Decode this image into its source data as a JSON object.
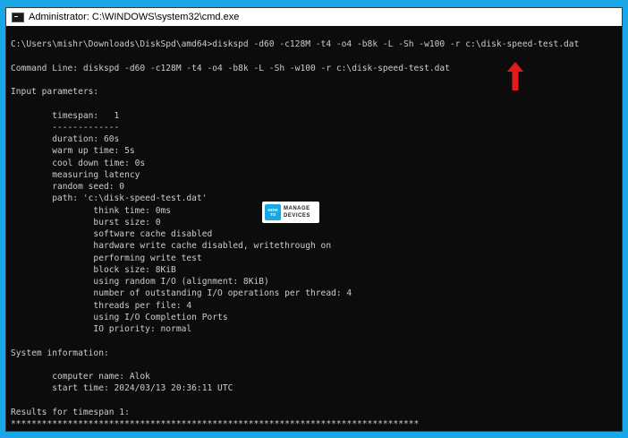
{
  "window": {
    "title": "Administrator: C:\\WINDOWS\\system32\\cmd.exe",
    "icon": "cmd-icon"
  },
  "console": {
    "lines": [
      "C:\\Users\\mishr\\Downloads\\DiskSpd\\amd64>diskspd -d60 -c128M -t4 -o4 -b8k -L -Sh -w100 -r c:\\disk-speed-test.dat",
      "",
      "Command Line: diskspd -d60 -c128M -t4 -o4 -b8k -L -Sh -w100 -r c:\\disk-speed-test.dat",
      "",
      "Input parameters:",
      "",
      "        timespan:   1",
      "        -------------",
      "        duration: 60s",
      "        warm up time: 5s",
      "        cool down time: 0s",
      "        measuring latency",
      "        random seed: 0",
      "        path: 'c:\\disk-speed-test.dat'",
      "                think time: 0ms",
      "                burst size: 0",
      "                software cache disabled",
      "                hardware write cache disabled, writethrough on",
      "                performing write test",
      "                block size: 8KiB",
      "                using random I/O (alignment: 8KiB)",
      "                number of outstanding I/O operations per thread: 4",
      "                threads per file: 4",
      "                using I/O Completion Ports",
      "                IO priority: normal",
      "",
      "System information:",
      "",
      "        computer name: Alok",
      "        start time: 2024/03/13 20:36:11 UTC",
      "",
      "Results for timespan 1:",
      "*******************************************************************************"
    ]
  },
  "watermark": {
    "badge_top": "HOW",
    "badge_bottom": "TO",
    "line1": "MANAGE",
    "line2": "DEVICES"
  },
  "colors": {
    "background": "#1aa7e8",
    "console_bg": "#0c0c0c",
    "console_fg": "#cccccc",
    "arrow": "#e31b1b"
  }
}
